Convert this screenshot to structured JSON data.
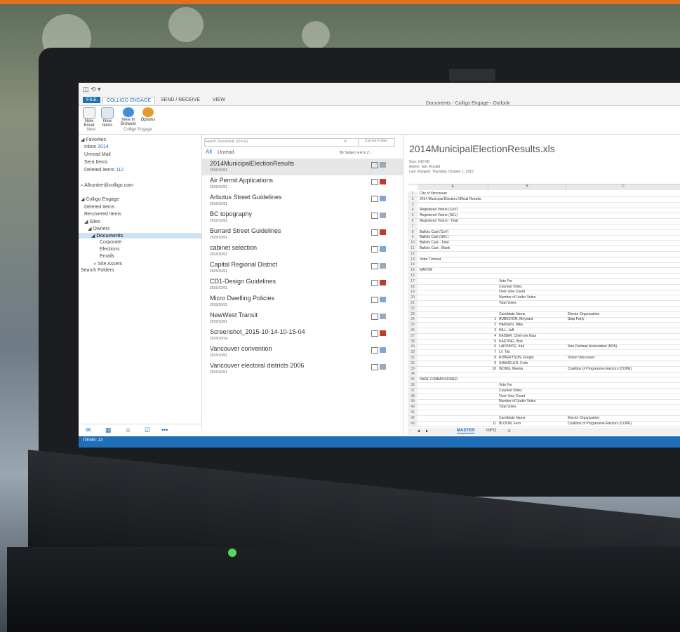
{
  "ribbon": {
    "tabs": [
      "FILE",
      "COLLIGO ENGAGE",
      "SEND / RECEIVE",
      "VIEW"
    ],
    "window_title": "Documents - Colligo Engage - Outlook",
    "buttons": [
      "New Email",
      "New Items",
      "View In Browser",
      "Options"
    ],
    "groups": [
      "New",
      "Colligo Engage"
    ]
  },
  "nav": {
    "favorites": "Favorites",
    "inbox": "Inbox",
    "inbox_count": "2014",
    "unread_mail": "Unread Mail",
    "sent_items": "Sent Items",
    "deleted_items": "Deleted Items",
    "deleted_count": "112",
    "account": "Albunker@colligo.com",
    "colligo_engage": "Colligo Engage",
    "deleted_items2": "Deleted Items",
    "recovered_items": "Recovered Items",
    "sites": "Sites",
    "owners": "Owners",
    "documents": "Documents",
    "corporate": "Corporate",
    "elections": "Elections",
    "emails": "Emails",
    "site_assets": "Site Assets",
    "search_folders": "Search Folders"
  },
  "status": "ITEMS: 13",
  "list": {
    "search_placeholder": "Search Documents (Ctrl+E)",
    "scope": "Current Folder",
    "filter_all": "All",
    "filter_unread": "Unread",
    "sort_by": "By Subject",
    "sort_order": "A to Z",
    "items": [
      {
        "name": "2014MunicipalElectionResults",
        "date": "2015/10/01"
      },
      {
        "name": "Air Permit Applications",
        "date": "2015/10/01"
      },
      {
        "name": "Arbutus Street Guidelines",
        "date": "2015/10/01"
      },
      {
        "name": "BC topography",
        "date": "2015/10/01"
      },
      {
        "name": "Burrard Street Guidelines",
        "date": "2015/10/01"
      },
      {
        "name": "cabinet selection",
        "date": "2015/10/01"
      },
      {
        "name": "Capital Regional District",
        "date": "2015/10/01"
      },
      {
        "name": "CD1-Design Guidelines",
        "date": "2015/10/01"
      },
      {
        "name": "Micro Dwelling Policies",
        "date": "2015/10/01"
      },
      {
        "name": "NewWest Transit",
        "date": "2015/10/01"
      },
      {
        "name": "Screenshot_2015-10-14-10-15-04",
        "date": "2015/10/14"
      },
      {
        "name": "Vancouver convention",
        "date": "2015/10/01"
      },
      {
        "name": "Vancouver electoral districts 2006",
        "date": "2015/10/01"
      }
    ]
  },
  "preview": {
    "title": "2014MunicipalElectionResults.xls",
    "size": "Size:  142 KB",
    "author": "Author:  Iain, Ronald",
    "changed": "Last changed:  Thursday, October 1, 2015",
    "col_a": "A",
    "col_b": "B",
    "col_c": "C",
    "rows": [
      {
        "n": "1",
        "a": "City of Vancouver",
        "num": "",
        "b": "",
        "c": ""
      },
      {
        "n": "2",
        "a": "2014 Municipal Election Official Results",
        "num": "",
        "b": "",
        "c": ""
      },
      {
        "n": "3",
        "a": "",
        "num": "",
        "b": "",
        "c": ""
      },
      {
        "n": "4",
        "a": "Registered Voters (CoV)",
        "num": "",
        "b": "",
        "c": ""
      },
      {
        "n": "5",
        "a": "Registered Voters (UEL)",
        "num": "",
        "b": "",
        "c": ""
      },
      {
        "n": "6",
        "a": "Registered Voters - Total",
        "num": "",
        "b": "",
        "c": ""
      },
      {
        "n": "7",
        "a": "",
        "num": "",
        "b": "",
        "c": ""
      },
      {
        "n": "8",
        "a": "Ballots Cast (CoV)",
        "num": "",
        "b": "",
        "c": ""
      },
      {
        "n": "9",
        "a": "Ballots Cast (UEL)",
        "num": "",
        "b": "",
        "c": ""
      },
      {
        "n": "10",
        "a": "Ballots Cast - Total",
        "num": "",
        "b": "",
        "c": ""
      },
      {
        "n": "11",
        "a": "Ballots Cast - Blank",
        "num": "",
        "b": "",
        "c": ""
      },
      {
        "n": "12",
        "a": "",
        "num": "",
        "b": "",
        "c": ""
      },
      {
        "n": "13",
        "a": "Voter Turnout",
        "num": "",
        "b": "",
        "c": ""
      },
      {
        "n": "14",
        "a": "",
        "num": "",
        "b": "",
        "c": ""
      },
      {
        "n": "15",
        "a": "MAYOR",
        "num": "",
        "b": "",
        "c": ""
      },
      {
        "n": "16",
        "a": "",
        "num": "",
        "b": "",
        "c": ""
      },
      {
        "n": "17",
        "a": "",
        "num": "",
        "b": "Vote For",
        "c": ""
      },
      {
        "n": "18",
        "a": "",
        "num": "",
        "b": "Counted Votes",
        "c": ""
      },
      {
        "n": "19",
        "a": "",
        "num": "",
        "b": "Over Vote Count",
        "c": ""
      },
      {
        "n": "20",
        "a": "",
        "num": "",
        "b": "Number of Under Votes",
        "c": ""
      },
      {
        "n": "21",
        "a": "",
        "num": "",
        "b": "Total Votes",
        "c": ""
      },
      {
        "n": "22",
        "a": "",
        "num": "",
        "b": "",
        "c": ""
      },
      {
        "n": "23",
        "a": "",
        "num": "",
        "b": "Candidate Name",
        "c": "Elector Organization"
      },
      {
        "n": "24",
        "a": "",
        "num": "1",
        "b": "AUBICHON, Meynard",
        "c": "Stop Party"
      },
      {
        "n": "25",
        "a": "",
        "num": "2",
        "b": "HANSEN, Mike",
        "c": ""
      },
      {
        "n": "26",
        "a": "",
        "num": "3",
        "b": "HILL, Jeff",
        "c": ""
      },
      {
        "n": "27",
        "a": "",
        "num": "4",
        "b": "KAISER, Cherryse Kaur",
        "c": ""
      },
      {
        "n": "28",
        "a": "",
        "num": "5",
        "b": "KASTING, Bob",
        "c": ""
      },
      {
        "n": "29",
        "a": "",
        "num": "6",
        "b": "LAPOINTE, Kirk",
        "c": "Non Partisan Association (NPA)"
      },
      {
        "n": "30",
        "a": "",
        "num": "7",
        "b": "LY, Tim",
        "c": ""
      },
      {
        "n": "31",
        "a": "",
        "num": "8",
        "b": "ROBERTSON, Gregor",
        "c": "Vision Vancouver"
      },
      {
        "n": "32",
        "a": "",
        "num": "9",
        "b": "SHANDLER, Colin",
        "c": ""
      },
      {
        "n": "33",
        "a": "",
        "num": "10",
        "b": "WONG, Meena",
        "c": "Coalition of Progressive Electors (COPE)"
      },
      {
        "n": "34",
        "a": "",
        "num": "",
        "b": "",
        "c": ""
      },
      {
        "n": "35",
        "a": "PARK COMMISSIONER",
        "num": "",
        "b": "",
        "c": ""
      },
      {
        "n": "36",
        "a": "",
        "num": "",
        "b": "Vote For",
        "c": ""
      },
      {
        "n": "37",
        "a": "",
        "num": "",
        "b": "Counted Votes",
        "c": ""
      },
      {
        "n": "38",
        "a": "",
        "num": "",
        "b": "Over Vote Count",
        "c": ""
      },
      {
        "n": "39",
        "a": "",
        "num": "",
        "b": "Number of Under Votes",
        "c": ""
      },
      {
        "n": "40",
        "a": "",
        "num": "",
        "b": "Total Votes",
        "c": ""
      },
      {
        "n": "41",
        "a": "",
        "num": "",
        "b": "",
        "c": ""
      },
      {
        "n": "42",
        "a": "",
        "num": "",
        "b": "Candidate Name",
        "c": "Elector Organization"
      },
      {
        "n": "43",
        "a": "",
        "num": "11",
        "b": "BLOOM, Fern",
        "c": "Coalition of Progressive Electors (COPE)"
      }
    ],
    "sheet_tabs": [
      "MASTER",
      "INFO"
    ]
  },
  "icons": {
    "navbar": [
      "mail-icon",
      "calendar-icon",
      "people-icon",
      "tasks-icon",
      "more-icon"
    ]
  }
}
